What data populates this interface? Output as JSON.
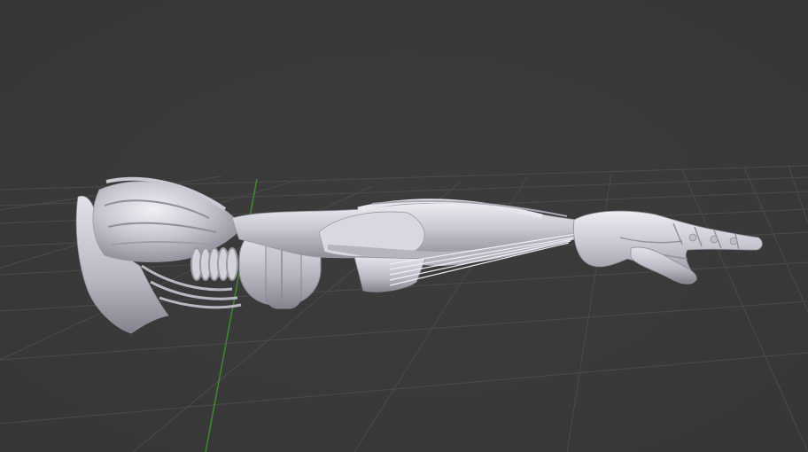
{
  "viewport": {
    "background_color": "#393939",
    "grid_color": "#4b4b4b",
    "y_axis_color": "#3f8a2e",
    "model_base_color": "#c9c9d3",
    "model_shadow_color": "#8f8f99",
    "model_highlight_color": "#ececf2"
  },
  "scene": {
    "object": "robotic-arm-model",
    "shading": "solid",
    "visible_axes": [
      "y-axis"
    ]
  }
}
